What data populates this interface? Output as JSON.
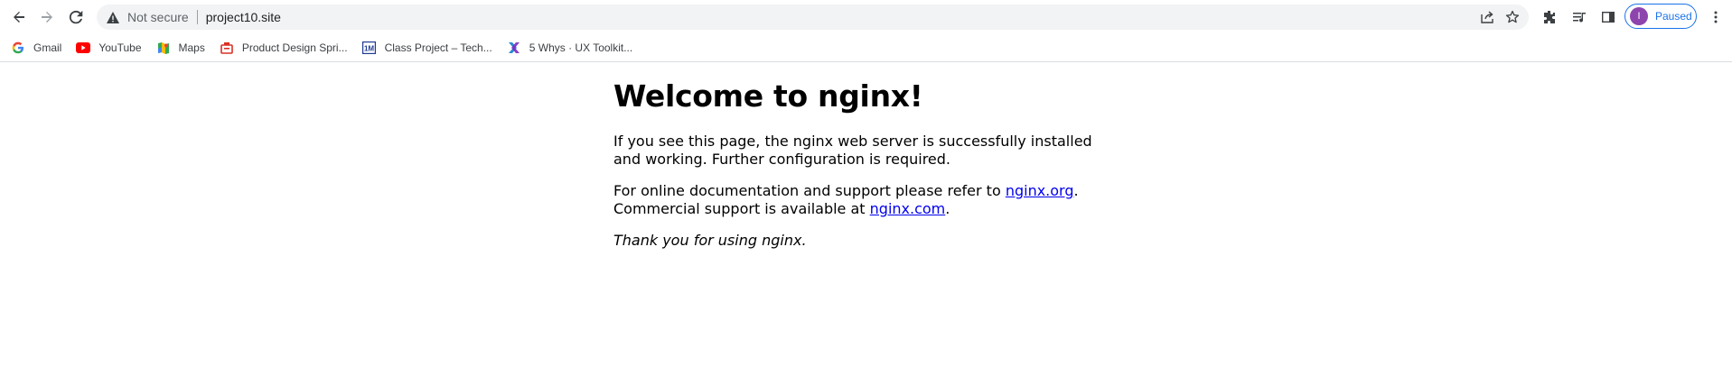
{
  "browser": {
    "security_label": "Not secure",
    "url": "project10.site",
    "profile": {
      "initial": "I",
      "status": "Paused"
    },
    "icons": [
      "back-arrow-icon",
      "forward-arrow-icon",
      "reload-icon",
      "warning-icon",
      "share-icon",
      "star-icon",
      "extensions-icon",
      "media-icon",
      "side-panel-icon",
      "more-vert-icon"
    ]
  },
  "bookmarks": [
    {
      "label": "Gmail",
      "icon": "google-icon"
    },
    {
      "label": "YouTube",
      "icon": "youtube-icon"
    },
    {
      "label": "Maps",
      "icon": "maps-icon"
    },
    {
      "label": "Product Design Spri...",
      "icon": "product-design-icon"
    },
    {
      "label": "Class Project – Tech...",
      "icon": "class-project-icon"
    },
    {
      "label": "5 Whys · UX Toolkit...",
      "icon": "ux-toolkit-icon"
    }
  ],
  "page": {
    "heading": "Welcome to nginx!",
    "p1": "If you see this page, the nginx web server is successfully installed and working. Further configuration is required.",
    "p2_prefix": "For online documentation and support please refer to ",
    "link1": "nginx.org",
    "p2_mid": ".",
    "p2_line2": "Commercial support is available at ",
    "link2": "nginx.com",
    "p2_end": ".",
    "thanks": "Thank you for using nginx."
  }
}
